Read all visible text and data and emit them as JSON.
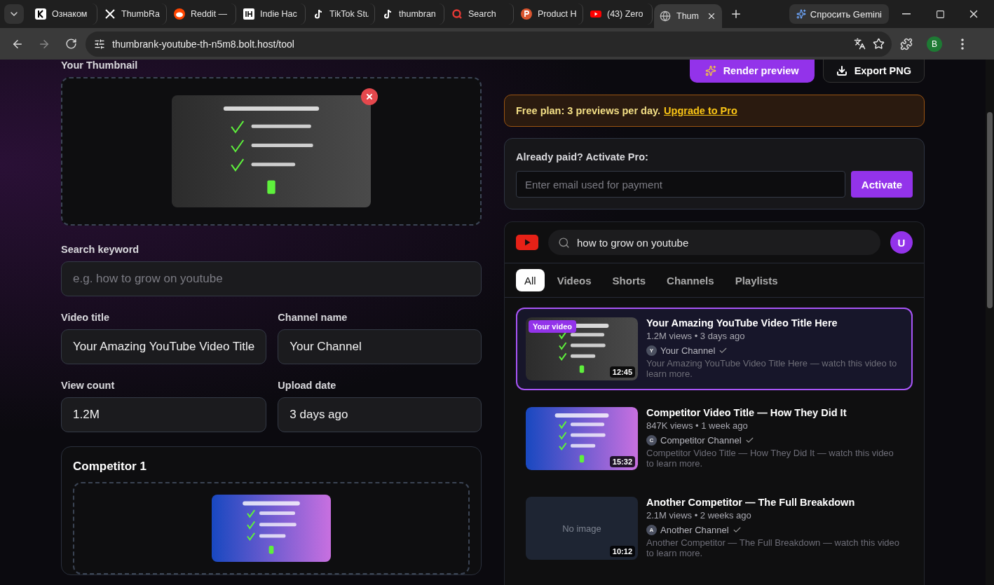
{
  "browser": {
    "tabs": [
      {
        "label": "Ознаком",
        "kind": "k",
        "selected": false
      },
      {
        "label": "ThumbRa",
        "kind": "x",
        "selected": false
      },
      {
        "label": "Reddit —",
        "kind": "reddit",
        "selected": false
      },
      {
        "label": "Indie Hac",
        "kind": "ih",
        "selected": false
      },
      {
        "label": "TikTok Stu",
        "kind": "tiktok",
        "selected": false
      },
      {
        "label": "thumbran",
        "kind": "tiktok",
        "selected": false
      },
      {
        "label": "Search",
        "kind": "search",
        "selected": false
      },
      {
        "label": "Product H",
        "kind": "product",
        "selected": false
      },
      {
        "label": "(43) Zero",
        "kind": "youtube",
        "selected": false
      },
      {
        "label": "Thum",
        "kind": "globe",
        "selected": true
      }
    ],
    "gemini": "Спросить Gemini",
    "address": "thumbrank-youtube-th-n5m8.bolt.host/tool",
    "profile": "B"
  },
  "editor": {
    "thumbnail_label": "Your Thumbnail",
    "search_keyword": {
      "label": "Search keyword",
      "placeholder": "e.g. how to grow on youtube"
    },
    "fields": [
      {
        "label": "Video title",
        "value": "Your Amazing YouTube Video Title"
      },
      {
        "label": "Channel name",
        "value": "Your Channel"
      },
      {
        "label": "View count",
        "value": "1.2M"
      },
      {
        "label": "Upload date",
        "value": "3 days ago"
      }
    ],
    "competitor": {
      "title": "Competitor 1"
    }
  },
  "actions": [
    {
      "label": "Render preview",
      "kind": "primary"
    },
    {
      "label": "Export PNG",
      "kind": "secondary"
    }
  ],
  "plan_banner": {
    "text": "Free plan: 3 previews per day.",
    "link": "Upgrade to Pro"
  },
  "activate": {
    "label": "Already paid? Activate Pro:",
    "placeholder": "Enter email used for payment",
    "button": "Activate"
  },
  "preview": {
    "search": "how to grow on youtube",
    "avatar": "U",
    "chips": [
      {
        "label": "All",
        "selected": true
      },
      {
        "label": "Videos",
        "selected": false
      },
      {
        "label": "Shorts",
        "selected": false
      },
      {
        "label": "Channels",
        "selected": false
      },
      {
        "label": "Playlists",
        "selected": false
      }
    ],
    "results": [
      {
        "title": "Your Amazing YouTube Video Title Here",
        "meta": "1.2M views • 3 days ago",
        "channel": "Your Channel",
        "initial": "Y",
        "description": "Your Amazing YouTube Video Title Here — watch this video to learn more.",
        "duration": "12:45",
        "badge": "Your video",
        "highlighted": true,
        "kind": "picture"
      },
      {
        "title": "Competitor Video Title — How They Did It",
        "meta": "847K views • 1 week ago",
        "channel": "Competitor Channel",
        "initial": "C",
        "description": "Competitor Video Title — How They Did It — watch this video to learn more.",
        "duration": "15:32",
        "highlighted": false,
        "kind": "picture"
      },
      {
        "title": "Another Competitor — The Full Breakdown",
        "meta": "2.1M views • 2 weeks ago",
        "channel": "Another Channel",
        "initial": "A",
        "description": "Another Competitor — The Full Breakdown — watch this video to learn more.",
        "duration": "10:12",
        "highlighted": false,
        "kind": "empty",
        "empty_text": "No image"
      }
    ]
  }
}
